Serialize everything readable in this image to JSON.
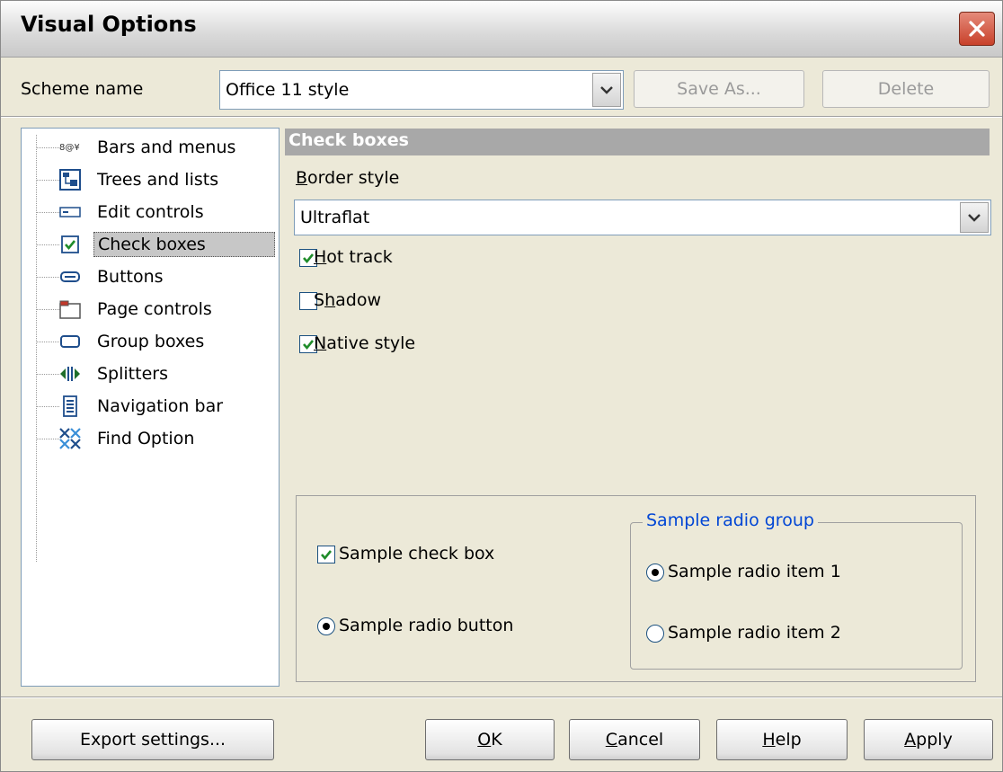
{
  "window": {
    "title": "Visual Options"
  },
  "scheme": {
    "label": "Scheme name",
    "value": "Office 11 style",
    "save_as": "Save As...",
    "delete": "Delete"
  },
  "tree": {
    "items": [
      {
        "label": "Bars and menus",
        "icon": "bars-menus-icon"
      },
      {
        "label": "Trees and lists",
        "icon": "tree-list-icon"
      },
      {
        "label": "Edit controls",
        "icon": "edit-control-icon"
      },
      {
        "label": "Check boxes",
        "icon": "checkbox-icon",
        "selected": true
      },
      {
        "label": "Buttons",
        "icon": "button-icon"
      },
      {
        "label": "Page controls",
        "icon": "page-control-icon"
      },
      {
        "label": "Group boxes",
        "icon": "group-box-icon"
      },
      {
        "label": "Splitters",
        "icon": "splitter-icon"
      },
      {
        "label": "Navigation bar",
        "icon": "navigation-bar-icon"
      },
      {
        "label": "Find Option",
        "icon": "find-option-icon"
      }
    ]
  },
  "panel": {
    "header": "Check boxes",
    "border_style_label": "Border style",
    "border_style_value": "Ultraflat",
    "hot_track": {
      "label": "Hot track",
      "checked": true
    },
    "shadow": {
      "label": "Shadow",
      "checked": false
    },
    "native_style": {
      "label": "Native style",
      "checked": true
    }
  },
  "sample": {
    "check_box": {
      "label": "Sample check box",
      "checked": true
    },
    "radio_button": {
      "label": "Sample radio button",
      "selected": true
    },
    "radio_group": {
      "title": "Sample radio group",
      "items": [
        {
          "label": "Sample radio item 1",
          "selected": true
        },
        {
          "label": "Sample radio item 2",
          "selected": false
        }
      ]
    }
  },
  "footer": {
    "export": "Export settings...",
    "ok": "OK",
    "cancel": "Cancel",
    "help": "Help",
    "apply": "Apply"
  },
  "colors": {
    "header_bg": "#a8a8a8",
    "group_title": "#0046d5",
    "close_red": "#c8412a"
  }
}
